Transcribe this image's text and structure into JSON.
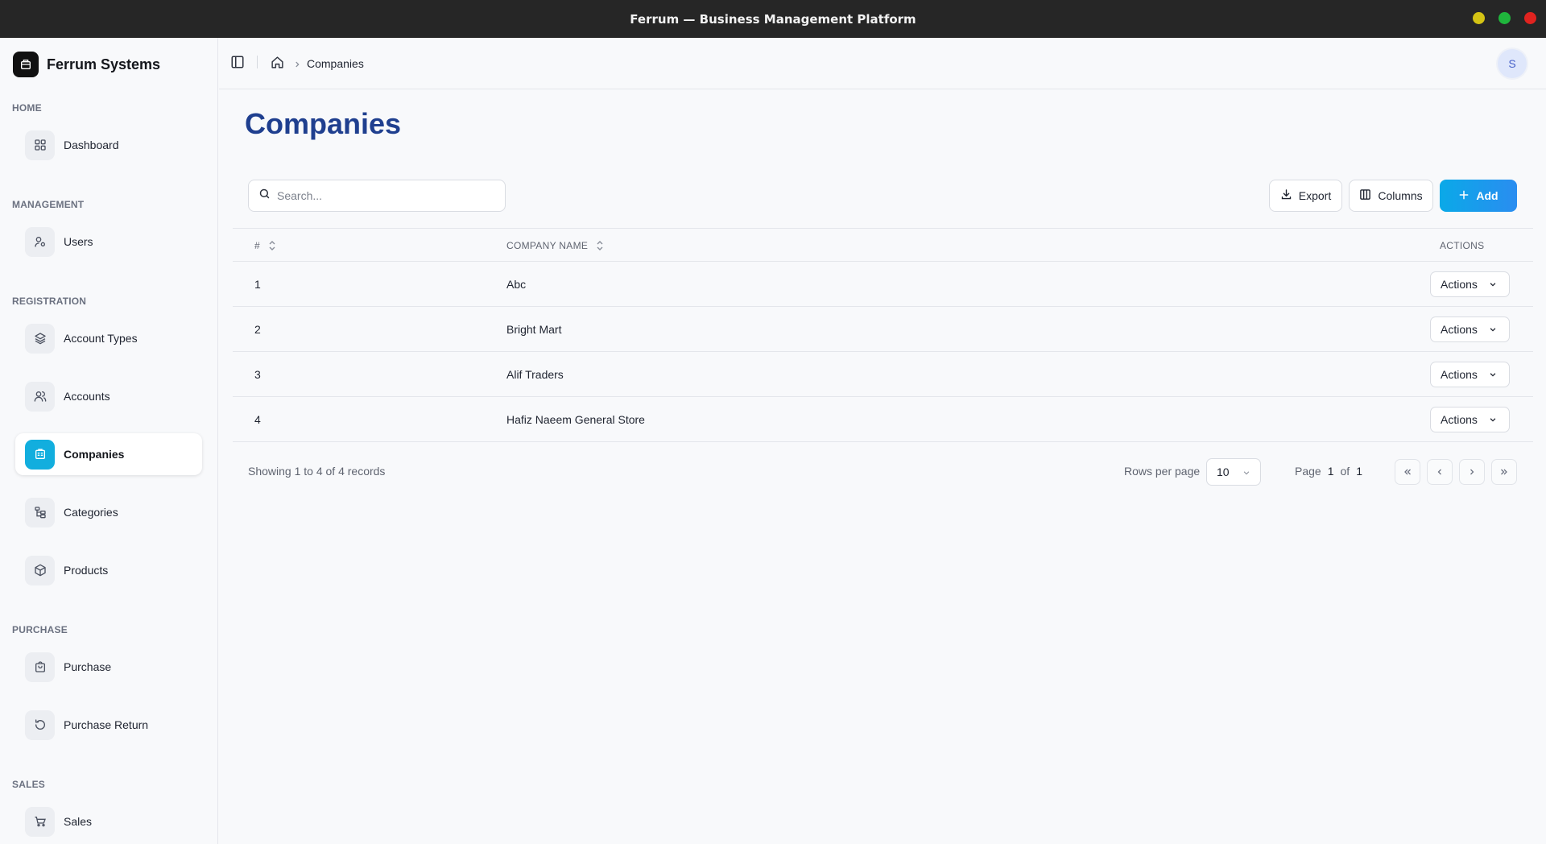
{
  "window": {
    "title": "Ferrum — Business Management Platform"
  },
  "brand": {
    "name": "Ferrum Systems"
  },
  "sidebar": {
    "sections": [
      {
        "label": "HOME",
        "items": [
          {
            "label": "Dashboard",
            "icon": "dashboard-icon"
          }
        ]
      },
      {
        "label": "MANAGEMENT",
        "items": [
          {
            "label": "Users",
            "icon": "users-icon"
          }
        ]
      },
      {
        "label": "REGISTRATION",
        "items": [
          {
            "label": "Account Types",
            "icon": "layers-icon"
          },
          {
            "label": "Accounts",
            "icon": "accounts-icon"
          },
          {
            "label": "Companies",
            "icon": "building-icon",
            "active": true
          },
          {
            "label": "Categories",
            "icon": "category-tree-icon"
          },
          {
            "label": "Products",
            "icon": "package-icon"
          }
        ]
      },
      {
        "label": "PURCHASE",
        "items": [
          {
            "label": "Purchase",
            "icon": "shopping-bag-icon"
          },
          {
            "label": "Purchase Return",
            "icon": "return-icon"
          }
        ]
      },
      {
        "label": "SALES",
        "items": [
          {
            "label": "Sales",
            "icon": "cart-icon"
          }
        ]
      }
    ]
  },
  "breadcrumb": {
    "current": "Companies"
  },
  "user": {
    "avatar_initial": "S"
  },
  "page": {
    "title": "Companies"
  },
  "toolbar": {
    "search_placeholder": "Search...",
    "export_label": "Export",
    "columns_label": "Columns",
    "add_label": "Add"
  },
  "table": {
    "columns": {
      "number": "#",
      "company_name": "COMPANY NAME",
      "actions": "ACTIONS"
    },
    "rows": [
      {
        "number": "1",
        "company_name": "Abc",
        "actions_label": "Actions"
      },
      {
        "number": "2",
        "company_name": "Bright Mart",
        "actions_label": "Actions"
      },
      {
        "number": "3",
        "company_name": "Alif Traders",
        "actions_label": "Actions"
      },
      {
        "number": "4",
        "company_name": "Hafiz Naeem General Store",
        "actions_label": "Actions"
      }
    ]
  },
  "pagination": {
    "showing": "Showing 1 to 4 of 4 records",
    "rows_per_page_label": "Rows per page",
    "rows_per_page_value": "10",
    "page_word": "Page",
    "current_page": "1",
    "of_word": "of",
    "total_pages": "1"
  },
  "colors": {
    "accent": "#12aede",
    "add_button": "#1a9cec",
    "page_title": "#1f3f8f",
    "titlebar": "#262626",
    "window_min": "#d4c314",
    "window_max": "#1fb53c",
    "window_close": "#e0231f"
  }
}
